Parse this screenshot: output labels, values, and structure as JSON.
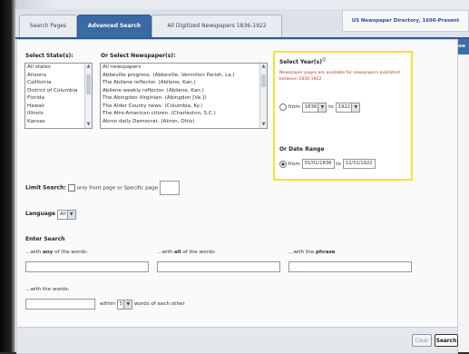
{
  "tabs": [
    {
      "label": "Search Pages"
    },
    {
      "label": "Advanced Search"
    },
    {
      "label": "All Digitized Newspapers 1836-1922"
    }
  ],
  "directory_link": "US Newspaper Directory, 1690-Present",
  "close_label": "close",
  "states": {
    "label": "Select State(s):",
    "options": [
      "All states",
      "Arizona",
      "California",
      "District of Columbia",
      "Florida",
      "Hawaii",
      "Illinois",
      "Kansas"
    ]
  },
  "newspapers": {
    "label": "Or Select Newspaper(s):",
    "options": [
      "All newspapers",
      "Abbeville progress. (Abbeville, Vermilion Parish, La.)",
      "The Abilene reflector. (Abilene, Kan.)",
      "Abilene weekly reflector. (Abilene, Kan.)",
      "The Abingdon Virginian. (Abingdon [Va.])",
      "The Alder County news. (Columbia, Ky.)",
      "The Afro-American citizen. (Charleston, S.C.)",
      "Akron daily Democrat. (Akron, Ohio)"
    ]
  },
  "years": {
    "label": "Select Year(s)",
    "note": "Newspaper pages are available for newspapers published between 1836-1922",
    "from_label": "from",
    "to_label": "to",
    "from_value": "1836",
    "to_value": "1922",
    "date_range_label": "Or Date Range",
    "date_from": "01/01/1836",
    "date_to": "12/31/1922"
  },
  "limit_search": {
    "label": "Limit Search:",
    "option_text": "only front page or Specific page"
  },
  "language": {
    "label": "Language",
    "value": "All"
  },
  "enter_search": {
    "label": "Enter Search",
    "any_prefix": "...with ",
    "any_word": "any",
    "any_suffix": " of the words:",
    "all_prefix": "...with ",
    "all_word": "all",
    "all_suffix": " of the words:",
    "phrase_prefix": "...with the ",
    "phrase_word": "phrase",
    "near_label": "...with the words:",
    "within_label": "within",
    "within_value": "5",
    "each_other_label": "words of each other"
  },
  "buttons": {
    "clear": "Clear",
    "search": "Search"
  }
}
